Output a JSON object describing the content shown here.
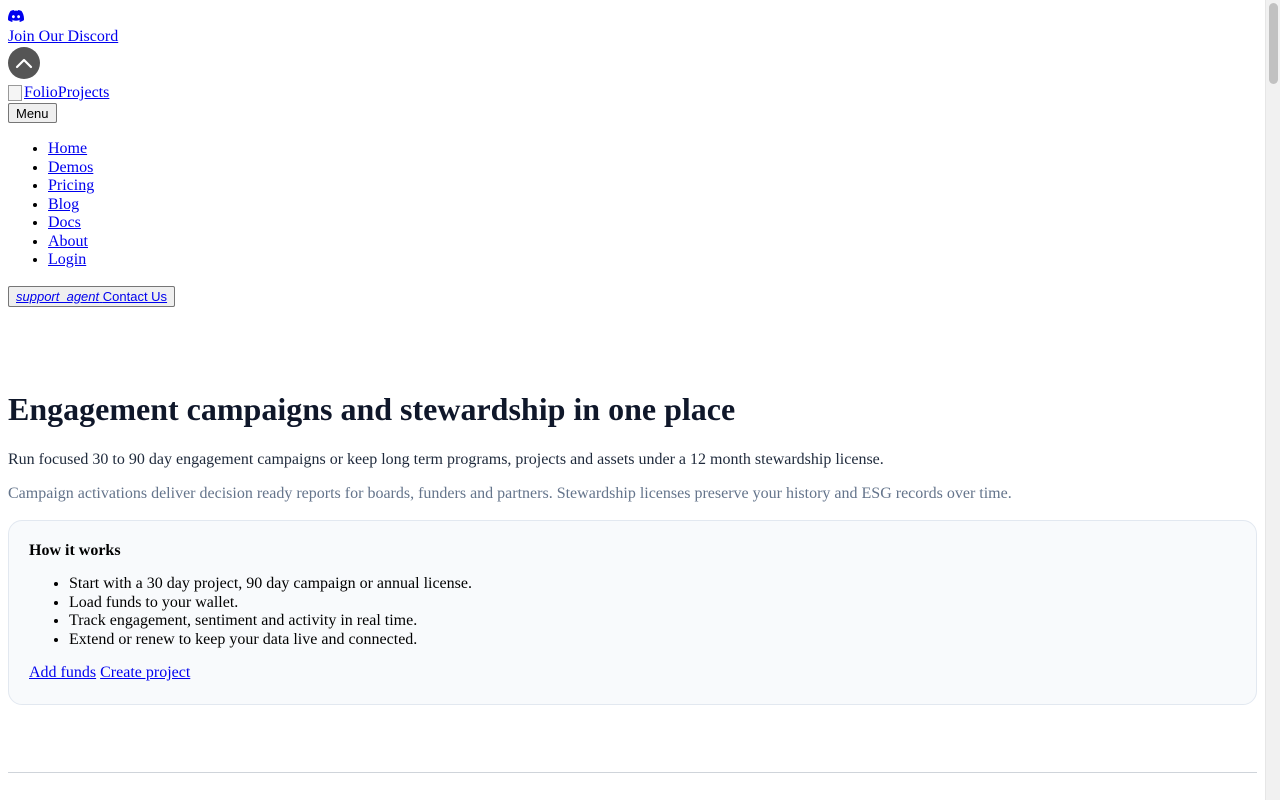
{
  "header": {
    "discord_link": "Join Our Discord",
    "logo_alt": "FolioProjects",
    "menu_button": "Menu"
  },
  "nav": {
    "items": [
      {
        "label": "Home"
      },
      {
        "label": "Demos"
      },
      {
        "label": "Pricing"
      },
      {
        "label": "Blog"
      },
      {
        "label": "Docs"
      },
      {
        "label": "About"
      },
      {
        "label": "Login"
      }
    ]
  },
  "contact": {
    "icon_text": "support_agent",
    "label": "Contact Us"
  },
  "hero": {
    "title": "Engagement campaigns and stewardship in one place",
    "lead": "Run focused 30 to 90 day engagement campaigns or keep long term programs, projects and assets under a 12 month stewardship license.",
    "sub": "Campaign activations deliver decision ready reports for boards, funders and partners. Stewardship licenses preserve your history and ESG records over time."
  },
  "how_it_works": {
    "title": "How it works",
    "steps": [
      "Start with a 30 day project, 90 day campaign or annual license.",
      "Load funds to your wallet.",
      "Track engagement, sentiment and activity in real time.",
      "Extend or renew to keep your data live and connected."
    ],
    "actions": {
      "add_funds": "Add funds",
      "create_project": "Create project"
    }
  },
  "icons": {
    "discord": "discord-icon",
    "scroll_top": "chevron-up-icon"
  },
  "colors": {
    "link": "#0000ee",
    "heading": "#0f172a",
    "muted": "#64748b",
    "card_bg": "#f8fafc"
  }
}
